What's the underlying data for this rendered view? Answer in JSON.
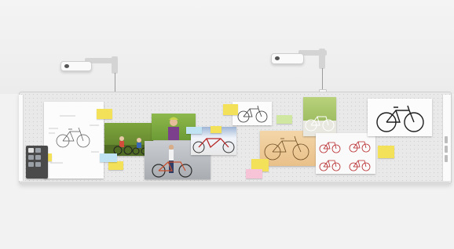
{
  "board": {
    "toolbar": {
      "tools": [
        "select-icon",
        "pen-icon",
        "shape-icon",
        "image-icon",
        "text-icon",
        "eraser-icon"
      ],
      "row_labels": [
        "",
        "",
        ""
      ]
    },
    "notes": [
      {
        "color": "yellow",
        "text": ""
      },
      {
        "color": "yellow",
        "text": ""
      },
      {
        "color": "yellow",
        "text": ""
      },
      {
        "color": "blue",
        "text": ""
      },
      {
        "color": "yellow",
        "text": ""
      },
      {
        "color": "blue",
        "text": ""
      },
      {
        "color": "yellow",
        "text": ""
      },
      {
        "color": "green",
        "text": ""
      },
      {
        "color": "yellow",
        "text": ""
      },
      {
        "color": "pink",
        "text": ""
      },
      {
        "color": "yellow",
        "text": ""
      }
    ],
    "items": [
      "sketch-sheet",
      "family-cycling-photo",
      "woman-with-bike-photo",
      "bike-courier-photo",
      "tandem-bike-photo",
      "bike-line-drawing",
      "orange-sketch",
      "green-bike-photo",
      "red-bikes-collage",
      "black-bike-photo"
    ]
  },
  "colors": {
    "wall": "#f2f2f2",
    "board": "#e9e9e9",
    "note_yellow": "#f4e15a",
    "note_blue": "#bfe3f3",
    "note_pink": "#f7c3d6",
    "note_green": "#cfe7a1",
    "toolbar": "#4a4a4a"
  }
}
